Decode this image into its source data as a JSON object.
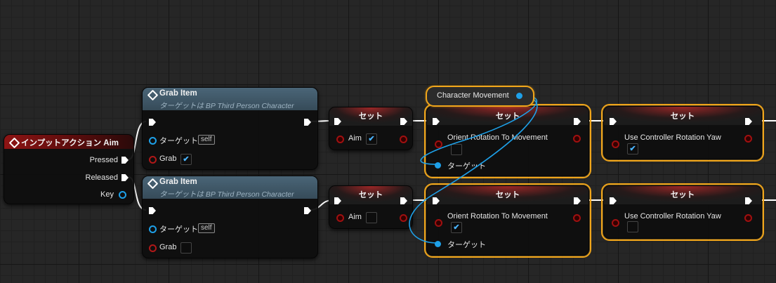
{
  "input_action": {
    "title": "インプットアクション Aim",
    "pins": {
      "pressed": "Pressed",
      "released": "Released",
      "key": "Key"
    }
  },
  "grab_top": {
    "title": "Grab Item",
    "subtitle": "ターゲットは BP Third Person Character",
    "target_label": "ターゲット",
    "self_text": "self",
    "grab_label": "Grab",
    "grab_checked": "✔"
  },
  "grab_bottom": {
    "title": "Grab Item",
    "subtitle": "ターゲットは BP Third Person Character",
    "target_label": "ターゲット",
    "self_text": "self",
    "grab_label": "Grab",
    "grab_checked": ""
  },
  "set_aim_top": {
    "title": "セット",
    "label": "Aim",
    "checked": "✔"
  },
  "set_aim_bottom": {
    "title": "セット",
    "label": "Aim",
    "checked": ""
  },
  "character_movement": {
    "label": "Character Movement"
  },
  "set_orient_top": {
    "title": "セット",
    "label": "Orient Rotation To Movement",
    "checked": "",
    "target_label": "ターゲット"
  },
  "set_orient_bottom": {
    "title": "セット",
    "label": "Orient Rotation To Movement",
    "checked": "✔",
    "target_label": "ターゲット"
  },
  "set_yaw_top": {
    "title": "セット",
    "label": "Use Controller Rotation Yaw",
    "checked": "✔"
  },
  "set_yaw_bottom": {
    "title": "セット",
    "label": "Use Controller Rotation Yaw",
    "checked": ""
  },
  "colors": {
    "exec_wire": "#ffffff",
    "object_wire": "#1ea0e8",
    "selection": "#f0a51a",
    "event_header": "#8e1414",
    "function_header": "#4a6577"
  }
}
